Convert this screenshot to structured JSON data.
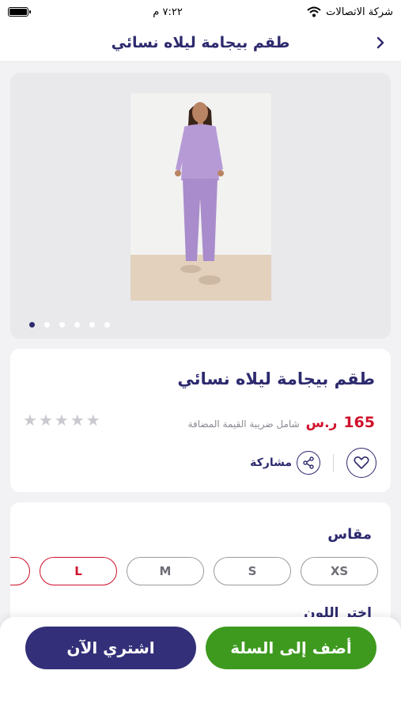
{
  "status_bar": {
    "carrier": "شركة الاتصالات",
    "time": "٧:٢٢ م"
  },
  "header": {
    "title": "طقم بيجامة ليلاه نسائي",
    "back_icon": "chevron-right-icon"
  },
  "gallery": {
    "image_count": 6,
    "active_index": 0
  },
  "product": {
    "title": "طقم بيجامة ليلاه نسائي",
    "price": "165",
    "currency": "ر.س",
    "vat_note": "شامل ضريبة القيمة المضافة",
    "rating_stars": 5,
    "rating_filled": 0,
    "share_label": "مشاركة"
  },
  "sizes": {
    "heading": "مقاس",
    "options": [
      "XS",
      "S",
      "M",
      "L"
    ],
    "selected": "L"
  },
  "color_heading": "اختر اللون",
  "footer": {
    "add_to_cart": "أضف إلى السلة",
    "buy_now": "اشتري الآن"
  },
  "colors": {
    "accent": "#2d2a6e",
    "price": "#d0112b",
    "add_button": "#3e9a1f",
    "buy_button": "#332f78"
  }
}
